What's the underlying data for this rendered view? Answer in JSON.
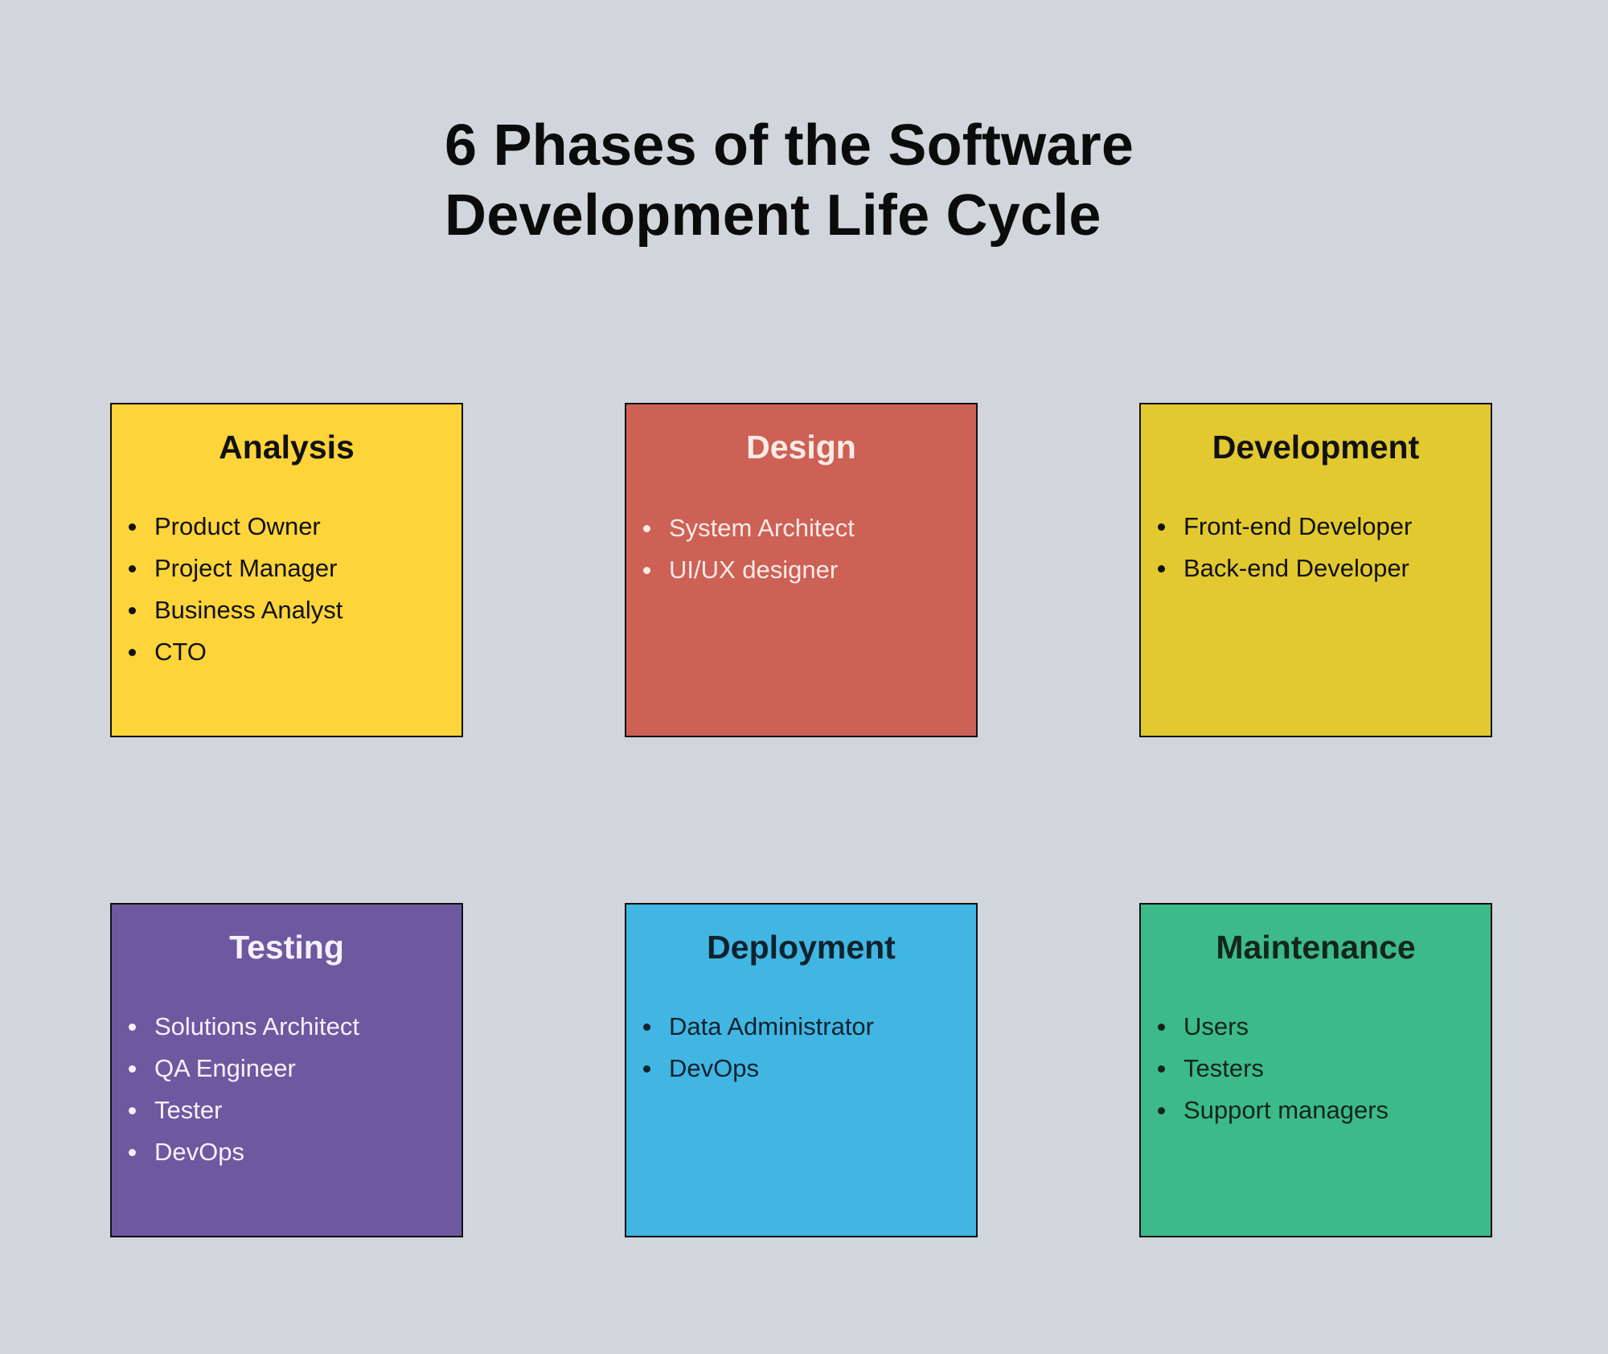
{
  "title": {
    "line1": "6 Phases of the Software",
    "line2": "Development Life Cycle"
  },
  "phases": [
    {
      "name": "Analysis",
      "color": "#fdd43a",
      "text_color": "#111111",
      "roles": [
        "Product Owner",
        "Project Manager",
        "Business Analyst",
        "CTO"
      ]
    },
    {
      "name": "Design",
      "color": "#cd6156",
      "text_color": "#fcebe6",
      "roles": [
        "System Architect",
        "UI/UX designer"
      ]
    },
    {
      "name": "Development",
      "color": "#e2c92f",
      "text_color": "#111111",
      "roles": [
        "Front-end Developer",
        "Back-end Developer"
      ]
    },
    {
      "name": "Testing",
      "color": "#6e58a0",
      "text_color": "#f6f1fb",
      "roles": [
        "Solutions Architect",
        "QA Engineer",
        "Tester",
        "DevOps"
      ]
    },
    {
      "name": "Deployment",
      "color": "#41b6e2",
      "text_color": "#10222e",
      "roles": [
        "Data Administrator",
        "DevOps"
      ]
    },
    {
      "name": "Maintenance",
      "color": "#3dba8a",
      "text_color": "#12261c",
      "roles": [
        "Users",
        "Testers",
        "Support managers"
      ]
    }
  ]
}
